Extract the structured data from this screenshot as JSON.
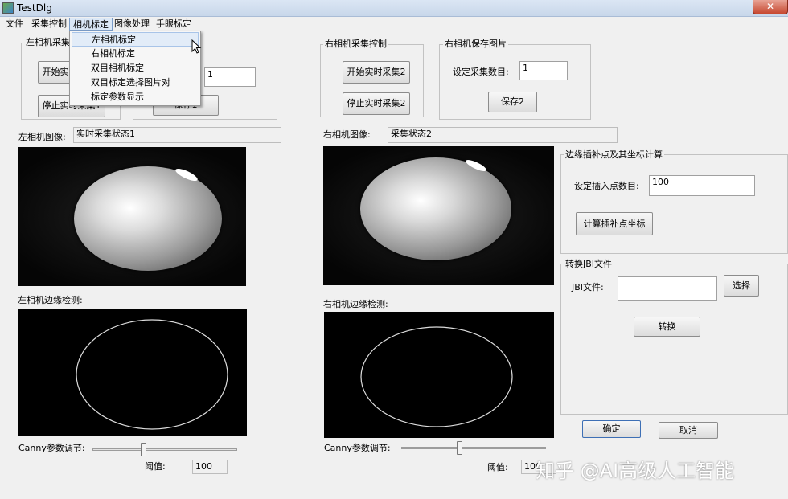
{
  "window": {
    "title": "TestDlg",
    "close_glyph": "✕"
  },
  "menu": [
    "文件",
    "采集控制",
    "相机标定",
    "图像处理",
    "手眼标定"
  ],
  "dropdown": [
    "左相机标定",
    "右相机标定",
    "双目相机标定",
    "双目标定选择图片对",
    "标定参数显示"
  ],
  "left": {
    "capture_group": "左相机采集控制",
    "start_btn": "开始实时采集1",
    "stop_btn": "停止实时采集1",
    "save_value": "1",
    "save_btn": "保存1",
    "image_label": "左相机图像:",
    "status": "实时采集状态1",
    "edge_label": "左相机边缘检测:",
    "canny_label": "Canny参数调节:",
    "threshold_label": "阈值:",
    "threshold_value": "100",
    "slider_value": 0.35
  },
  "right": {
    "capture_group": "右相机采集控制",
    "start_btn": "开始实时采集2",
    "stop_btn": "停止实时采集2",
    "save_group": "右相机保存图片",
    "count_label": "设定采集数目:",
    "count_value": "1",
    "save_btn": "保存2",
    "image_label": "右相机图像:",
    "status": "采集状态2",
    "edge_label": "右相机边缘检测:",
    "canny_label": "Canny参数调节:",
    "threshold_label": "阈值:",
    "threshold_value": "100",
    "slider_value": 0.4
  },
  "interp": {
    "group": "边缘插补点及其坐标计算",
    "count_label": "设定插入点数目:",
    "count_value": "100",
    "calc_btn": "计算插补点坐标"
  },
  "jbi": {
    "group": "转换JBI文件",
    "file_label": "JBI文件:",
    "file_value": "",
    "select_btn": "选择",
    "convert_btn": "转换"
  },
  "dialog": {
    "ok": "确定",
    "cancel": "取消"
  },
  "watermark": "知乎 @AI高级人工智能",
  "icons": [
    "app-icon",
    "close-icon",
    "cursor-icon"
  ]
}
